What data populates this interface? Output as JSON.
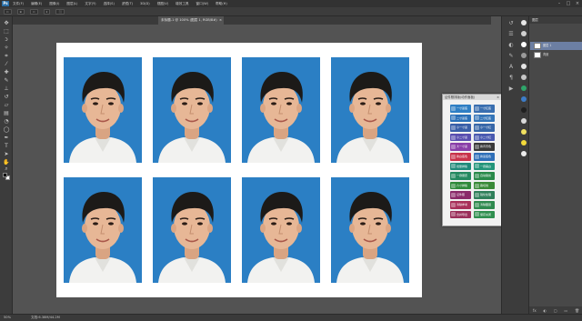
{
  "menubar": {
    "logo": "Ps",
    "items": [
      "文件(F)",
      "编辑(E)",
      "图像(I)",
      "图层(L)",
      "文字(Y)",
      "选择(S)",
      "滤镜(T)",
      "3D(D)",
      "视图(V)",
      "增效工具",
      "窗口(W)",
      "帮助(H)"
    ]
  },
  "window_controls": {
    "minimize": "–",
    "maximize": "□",
    "close": "×"
  },
  "optionsbar": {
    "items": [
      "⇔",
      "⊕",
      "⇔",
      "2",
      "⬛"
    ]
  },
  "document_tab": {
    "title": "未标题-1 @ 100% (图层 1, RGB/8#)",
    "close": "×"
  },
  "statusbar": {
    "zoom": "50%",
    "docinfo": "文档:6.38M/44.2M"
  },
  "action_panel": {
    "title": "证件照排版(动作面板)",
    "close": "×",
    "buttons": [
      {
        "label": "一寸蓝底",
        "color": "#2f7fc4"
      },
      {
        "label": "一寸红底",
        "color": "#3a6fb0"
      },
      {
        "label": "二寸蓝底",
        "color": "#2a70b8"
      },
      {
        "label": "二寸红底",
        "color": "#3575b8"
      },
      {
        "label": "小一寸蓝",
        "color": "#3a5fa8"
      },
      {
        "label": "小一寸红",
        "color": "#3867a8"
      },
      {
        "label": "小二寸蓝",
        "color": "#5a4fb0"
      },
      {
        "label": "小二寸红",
        "color": "#4a5ab0"
      },
      {
        "label": "大一寸蓝",
        "color": "#8a3fa8"
      },
      {
        "label": "换背景色",
        "color": "#3a3a3a"
      },
      {
        "label": "换白底色",
        "color": "#c8324a"
      },
      {
        "label": "换蓝底色",
        "color": "#2f6fb8"
      },
      {
        "label": "批量排版",
        "color": "#1f8a7a"
      },
      {
        "label": "一键美白",
        "color": "#23957a"
      },
      {
        "label": "一键磨皮",
        "color": "#258a60"
      },
      {
        "label": "自动裁剪",
        "color": "#2a8a4a"
      },
      {
        "label": "六寸排版",
        "color": "#2f8a3a"
      },
      {
        "label": "裁切线",
        "color": "#3a8a38"
      },
      {
        "label": "证件照",
        "color": "#8a2a6a"
      },
      {
        "label": "锐化处理",
        "color": "#2f7f5a"
      },
      {
        "label": "清除参考",
        "color": "#a8305a"
      },
      {
        "label": "清除图层",
        "color": "#2f8a4f"
      },
      {
        "label": "合并导出",
        "color": "#9a2f5a"
      },
      {
        "label": "保存关闭",
        "color": "#2f8f4f"
      }
    ]
  },
  "layers_panel": {
    "header": "图层",
    "rows": [
      {
        "label": "图层 1",
        "selected": true
      },
      {
        "label": "背景",
        "selected": false
      }
    ],
    "footer_icons": [
      "fx",
      "◐",
      "▢",
      "▭",
      "🗑"
    ]
  },
  "photos": {
    "background_color": "#2b7fc4",
    "count": 8
  },
  "colors": {
    "app_bg": "#535353",
    "paper": "#ffffff",
    "id_photo_bg": "#2b7fc4"
  }
}
